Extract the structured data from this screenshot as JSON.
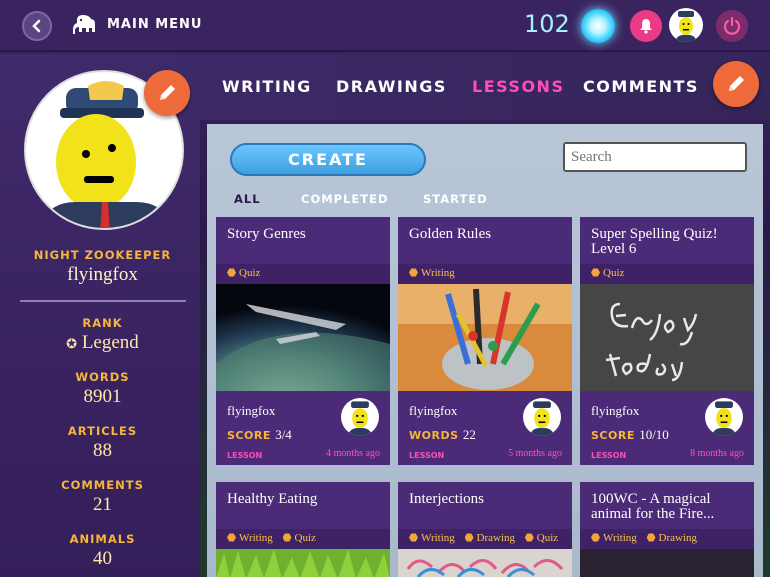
{
  "topbar": {
    "main_menu": "MAIN MENU",
    "coins": "102",
    "icons": [
      "back-arrow-icon",
      "elephant-icon",
      "orb-icon",
      "bell-icon",
      "avatar",
      "power-icon"
    ],
    "colors": {
      "bell": "#ea3b86",
      "orb": "#38d2ff",
      "coins": "#a8f0ff"
    }
  },
  "nav": {
    "tabs": [
      {
        "label": "WRITING",
        "active": false
      },
      {
        "label": "DRAWINGS",
        "active": false
      },
      {
        "label": "LESSONS",
        "active": true
      },
      {
        "label": "COMMENTS",
        "active": false
      }
    ],
    "accent": "#ff4fb6"
  },
  "profile": {
    "title": "NIGHT ZOOKEEPER",
    "username": "flyingfox",
    "stats": [
      {
        "label": "RANK",
        "value": "Legend"
      },
      {
        "label": "WORDS",
        "value": "8901"
      },
      {
        "label": "ARTICLES",
        "value": "88"
      },
      {
        "label": "COMMENTS",
        "value": "21"
      },
      {
        "label": "ANIMALS",
        "value": "40"
      }
    ]
  },
  "toolbar": {
    "create_label": "CREATE",
    "search_placeholder": "Search",
    "filters": [
      {
        "label": "ALL",
        "active": true
      },
      {
        "label": "COMPLETED",
        "active": false
      },
      {
        "label": "STARTED",
        "active": false
      }
    ]
  },
  "cards": [
    {
      "title": "Story Genres",
      "tags": [
        "Quiz"
      ],
      "author": "flyingfox",
      "metric_label": "SCORE",
      "metric_value": "3/4",
      "type": "LESSON",
      "time": "4 months ago",
      "image": "space-station-earth"
    },
    {
      "title": "Golden Rules",
      "tags": [
        "Writing"
      ],
      "author": "flyingfox",
      "metric_label": "WORDS",
      "metric_value": "22",
      "type": "LESSON",
      "time": "5 months ago",
      "image": "pens-in-cup"
    },
    {
      "title": "Super Spelling Quiz! Level 6",
      "tags": [
        "Quiz"
      ],
      "author": "flyingfox",
      "metric_label": "SCORE",
      "metric_value": "10/10",
      "type": "LESSON",
      "time": "8 months ago",
      "image": "enjoy-today-chalkboard"
    },
    {
      "title": "Healthy Eating",
      "tags": [
        "Writing",
        "Quiz"
      ],
      "image": "grass"
    },
    {
      "title": "Interjections",
      "tags": [
        "Writing",
        "Drawing",
        "Quiz"
      ],
      "image": "paperclips"
    },
    {
      "title": "100WC - A magical animal for the Fire...",
      "tags": [
        "Writing",
        "Drawing"
      ],
      "image": "dark-photo"
    }
  ]
}
